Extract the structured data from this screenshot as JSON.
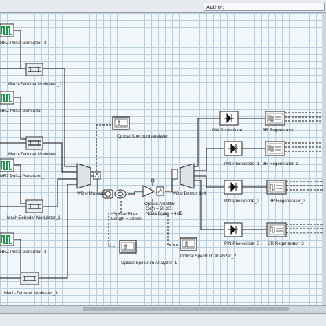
{
  "header": {
    "author_label": "Author:"
  },
  "components": {
    "pg2": "NRZ Pulse Generator_2",
    "mzm2": "Mach-Zehnder Modulator_2",
    "pgA": "NRZ Pulse Generator",
    "mzmA": "Mach-Zehnder Modulator",
    "pg1": "NRZ Pulse Generator_1",
    "mzm1": "Mach-Zehnder Modulator_1",
    "pg3": "NRZ Pulse Generator_3",
    "mzm3": "Mach-Zehnder Modulator_3",
    "mux": "WDM Mux 4x1",
    "osa": "Optical Spectrum Analyzer",
    "osa1": "Optical Spectrum Analyzer_1",
    "osa2": "Optical Spectrum Analyzer_2",
    "fiber": "Optical Fiber",
    "fiber_len": "Length = 10 km",
    "amp": "Optical Amplifier",
    "amp_gain": "Gain = 20 dB",
    "amp_nf": "Noise figure = 4 dB",
    "demux": "WDM Demux 1x4",
    "pin": "PIN Photodiode",
    "pin1": "PIN Photodiode_1",
    "pin2": "PIN Photodiode_2",
    "pin3": "PIN Photodiode_3",
    "reg": "3R Regenerator",
    "reg1": "3R Regenerator_1",
    "reg2": "3R Regenerator_2",
    "reg3": "3R Regenerator_3"
  },
  "colors": {
    "grid": "#b9cfdf",
    "canvas": "#f2f7fb",
    "wire": "#111111",
    "pulse": "#1a9a4a"
  }
}
